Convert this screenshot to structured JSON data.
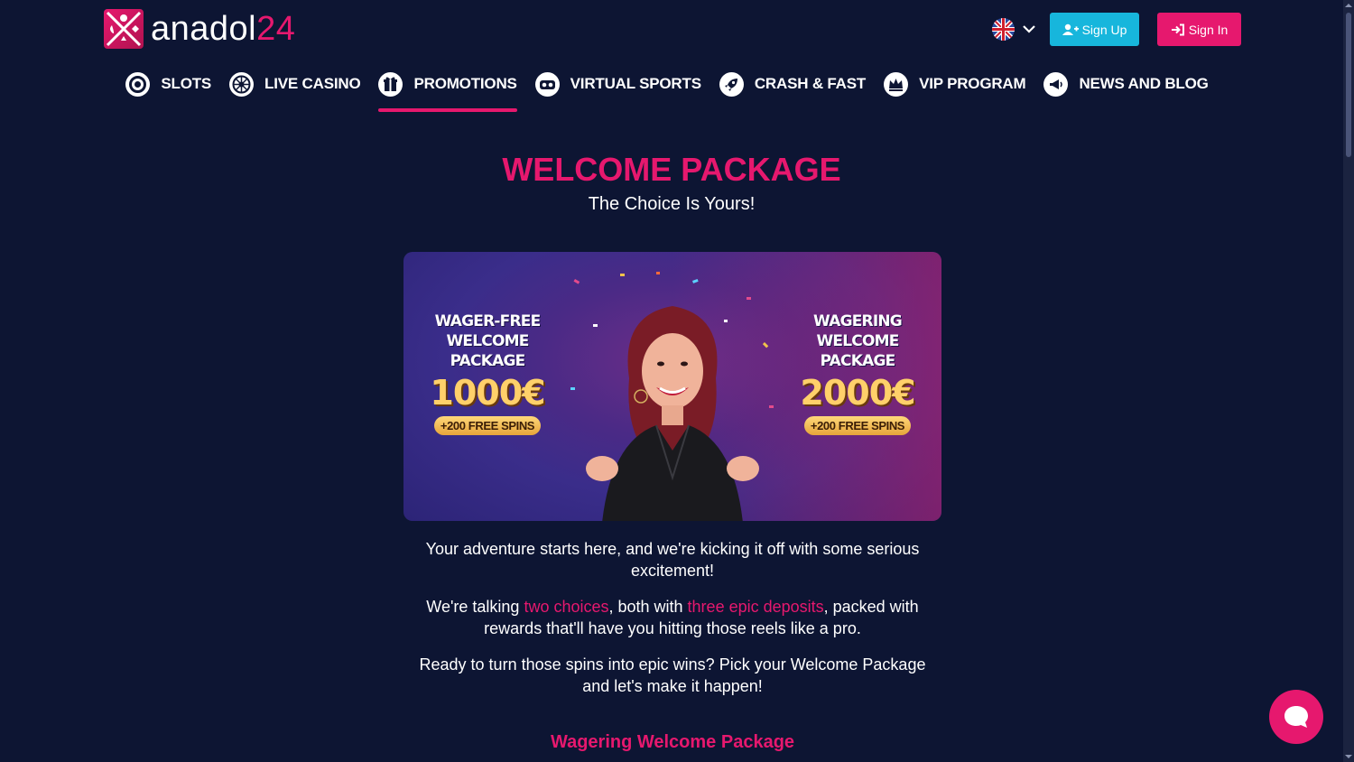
{
  "brand": {
    "name_main": "anadol",
    "name_accent": "24"
  },
  "header": {
    "language": "English",
    "signup_label": "Sign Up",
    "signin_label": "Sign In"
  },
  "nav": {
    "items": [
      {
        "label": "SLOTS",
        "icon": "slots-chip-icon"
      },
      {
        "label": "LIVE CASINO",
        "icon": "roulette-icon"
      },
      {
        "label": "PROMOTIONS",
        "icon": "gift-icon",
        "active": true
      },
      {
        "label": "VIRTUAL SPORTS",
        "icon": "vr-goggles-icon"
      },
      {
        "label": "CRASH & FAST",
        "icon": "rocket-icon"
      },
      {
        "label": "VIP PROGRAM",
        "icon": "crown-icon"
      },
      {
        "label": "NEWS AND BLOG",
        "icon": "megaphone-icon"
      }
    ]
  },
  "main": {
    "title": "WELCOME PACKAGE",
    "subtitle": "The Choice Is Yours!",
    "banner": {
      "left": {
        "line1": "WAGER-FREE",
        "line2": "WELCOME PACKAGE",
        "amount": "1000€",
        "spins": "+200 FREE SPINS"
      },
      "right": {
        "line1": "WAGERING",
        "line2": "WELCOME PACKAGE",
        "amount": "2000€",
        "spins": "+200 FREE SPINS"
      }
    },
    "para1": "Your adventure starts here, and we're kicking it off with some serious excitement!",
    "para2_a": "We're talking ",
    "para2_hl1": "two choices",
    "para2_b": ", both with ",
    "para2_hl2": "three epic deposits",
    "para2_c": ", packed with rewards that'll have you hitting those reels like a pro.",
    "para3": "Ready to turn those spins into epic wins? Pick your Welcome Package and let's make it happen!",
    "section_title": "Wagering Welcome Package"
  },
  "colors": {
    "background": "#0d1533",
    "accent": "#e6186e",
    "signup": "#17b6dc"
  }
}
